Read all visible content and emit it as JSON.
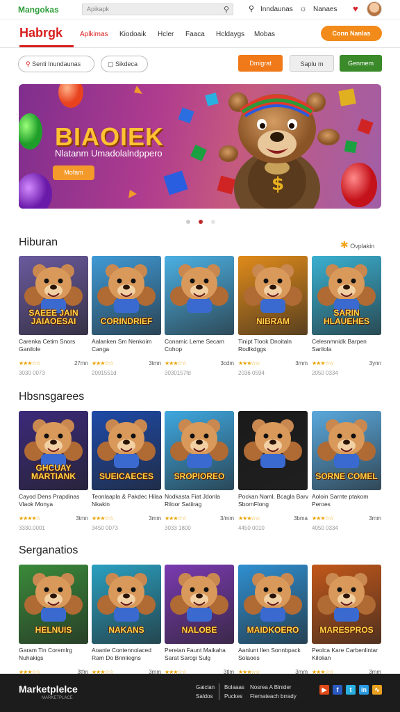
{
  "topbar": {
    "logo": "Mangokas",
    "search_placeholder": "Apikapk",
    "links": [
      "Inndaunas",
      "Nanaes"
    ]
  },
  "header": {
    "brand": "Habrgk",
    "nav": [
      "Aplkimas",
      "Kiodoaik",
      "Hcler",
      "Faaca",
      "Hcldaygs",
      "Mobas"
    ],
    "cta": "Conn Nanlas"
  },
  "filters": {
    "search_label": "Senti Inundaunas",
    "second_label": "Sikdeca",
    "btn1": "Dmigrat",
    "btn2": "Saplu m",
    "btn3": "Genmem"
  },
  "banner": {
    "title": "BIAOIEK",
    "subtitle": "Nlatanm Umadolalndppero",
    "button": "Mofam"
  },
  "sections": [
    {
      "title": "Hiburan",
      "more": "Ovplakin",
      "cards": [
        {
          "art": "SAEEE JAIN JAIAOESAI",
          "name": "Carenka Cetim Snors Ganilole",
          "stars": "★★★☆☆",
          "price": "27mn",
          "id": "3030 0073",
          "bg": "#6a5a9e"
        },
        {
          "art": "CORINDRIEF",
          "name": "Aalanken Sm Nenkoim Canga",
          "stars": "★★★☆☆",
          "price": "3tmn",
          "id": "2001551d",
          "bg": "#3f9ad6"
        },
        {
          "art": "",
          "name": "Conamic Leme Secam Cohop",
          "stars": "★★★☆☆",
          "price": "3cdm",
          "id": "3030157fd",
          "bg": "#4bb0e3"
        },
        {
          "art": "NIBRAM",
          "name": "Tinipt Tlook Dnoitaln Rodlkdggs",
          "stars": "★★★☆☆",
          "price": "3mm",
          "id": "2036 0594",
          "bg": "#e08b1a"
        },
        {
          "art": "SARIN HLAUEHES",
          "name": "Celesnmnidk Barpen Sarilola",
          "stars": "★★★☆☆",
          "price": "3ynn",
          "id": "2050 0334",
          "bg": "#3ab0d0"
        }
      ]
    },
    {
      "title": "Hbsnsgarees",
      "more": "",
      "cards": [
        {
          "art": "GHCUAY MARTIANK",
          "name": "Cayod Dens Prapdinas Vlaok Monya",
          "stars": "★★★★☆",
          "price": "3tmn",
          "id": "3330.0001",
          "bg": "#3b2a7a"
        },
        {
          "art": "SUEICAECES",
          "name": "Teonlaapla & Pakdec Hilaa Nkakin",
          "stars": "★★★☆☆",
          "price": "3mm",
          "id": "3450 0073",
          "bg": "#1e4aa8"
        },
        {
          "art": "SROPIOREO",
          "name": "Nodkasta Fiat Jdonla Riloor Satiirag",
          "stars": "★★★☆☆",
          "price": "3/mm",
          "id": "3033 1800",
          "bg": "#3fa8e0"
        },
        {
          "art": "",
          "name": "Pockan Naml, Bcagla Barv SbornFlong",
          "stars": "★★★☆☆",
          "price": "3bma",
          "id": "4450 0010",
          "bg": "#1a1a1a"
        },
        {
          "art": "SORNE COMEL",
          "name": "Aoloin Sarnte ptakom Peroes",
          "stars": "★★★☆☆",
          "price": "3mm",
          "id": "4050 0334",
          "bg": "#5aa8dc"
        }
      ]
    },
    {
      "title": "Serganatios",
      "more": "",
      "cards": [
        {
          "art": "HELNUIS",
          "name": "Garam Tin Coremlrg Nuhakigs",
          "stars": "★★★☆☆",
          "price": "3tfm",
          "id": "",
          "bg": "#3a8a3a"
        },
        {
          "art": "NAKANS",
          "name": "Aoanle Contennolaced Ram Do Bnnliegns",
          "stars": "★★★☆☆",
          "price": "3mm",
          "id": "",
          "bg": "#2aa0c0"
        },
        {
          "art": "NALOBE",
          "name": "Pereian Faunt Maikaha Sarat Sarcgi Sulg",
          "stars": "★★★☆☆",
          "price": "3tlm",
          "id": "",
          "bg": "#7a3ab0"
        },
        {
          "art": "MAIDKOERO",
          "name": "Aanlunt Ilen Sonnbpack Solaoes",
          "stars": "★★★☆☆",
          "price": "3mm",
          "id": "",
          "bg": "#2f8fd0"
        },
        {
          "art": "MARESPROS",
          "name": "Peolca Kare Carbenlintar Kilolian",
          "stars": "★★★☆☆",
          "price": "3mm",
          "id": "",
          "bg": "#c2571a"
        }
      ]
    }
  ],
  "footer": {
    "logo": "Marketplelce",
    "sub": "MARKETPLACE",
    "links": [
      "Gaiclan",
      "Saldos",
      "Bolaaas",
      "Puckes",
      "Nosrea A Blnider",
      "Flemateach brrady"
    ]
  },
  "colors": {
    "accent": "#d81e1e",
    "orange": "#f28b1a",
    "green": "#3a8a2a"
  }
}
